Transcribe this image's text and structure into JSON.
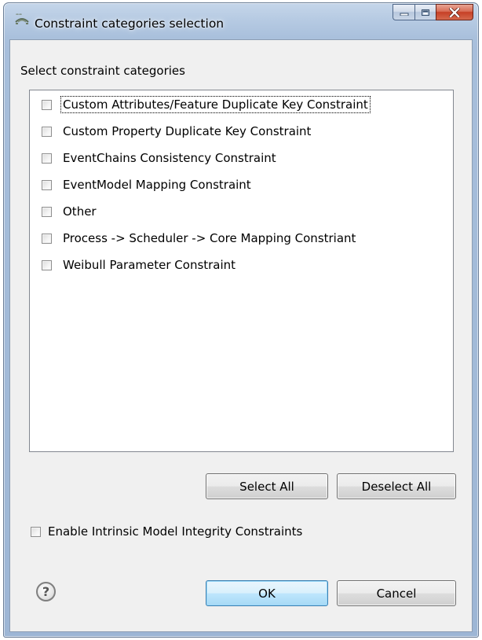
{
  "window": {
    "title": "Constraint categories selection",
    "icon": "eclipse-dialog-icon"
  },
  "section_label": "Select constraint categories",
  "categories": [
    {
      "label": "Custom Attributes/Feature Duplicate Key Constraint",
      "checked": false,
      "focused": true
    },
    {
      "label": "Custom Property Duplicate Key Constraint",
      "checked": false
    },
    {
      "label": "EventChains Consistency Constraint",
      "checked": false
    },
    {
      "label": "EventModel Mapping Constraint",
      "checked": false
    },
    {
      "label": "Other",
      "checked": false
    },
    {
      "label": "Process -> Scheduler -> Core Mapping Constriant",
      "checked": false
    },
    {
      "label": "Weibull Parameter Constraint",
      "checked": false
    }
  ],
  "buttons": {
    "select_all": "Select All",
    "deselect_all": "Deselect All",
    "ok": "OK",
    "cancel": "Cancel"
  },
  "intrinsic": {
    "label": "Enable Intrinsic Model Integrity Constraints",
    "checked": false
  },
  "help": {
    "glyph": "?"
  },
  "colors": {
    "frame": "#b7cbe3",
    "client_bg": "#f0f0f0",
    "close_button": "#c63f25",
    "default_button": "#bee6fd"
  }
}
